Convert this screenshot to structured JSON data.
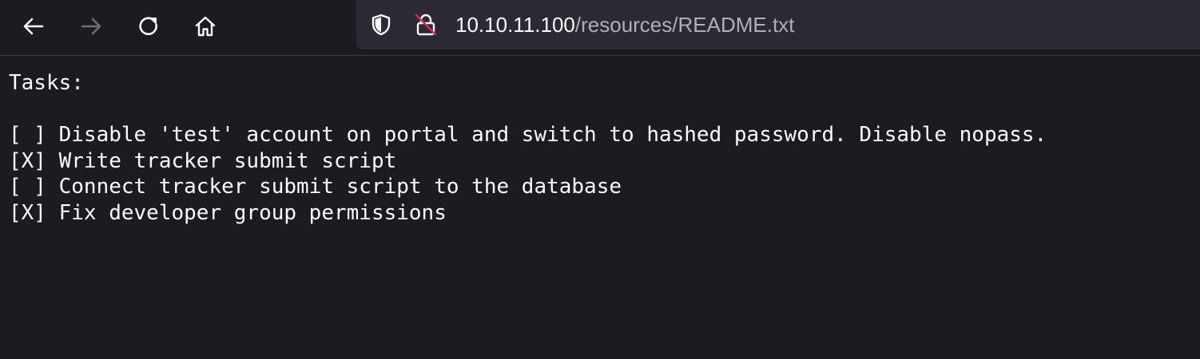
{
  "browser": {
    "url_host": "10.10.11.100",
    "url_path": "/resources/README.txt",
    "icons": {
      "back": "back-arrow-icon",
      "forward": "forward-arrow-icon",
      "reload": "reload-icon",
      "home": "home-icon",
      "tracking": "shield-icon",
      "security": "insecure-lock-icon"
    }
  },
  "document": {
    "lines": [
      "Tasks:",
      "",
      "[ ] Disable 'test' account on portal and switch to hashed password. Disable nopass.",
      "[X] Write tracker submit script",
      "[ ] Connect tracker submit script to the database",
      "[X] Fix developer group permissions"
    ]
  },
  "colors": {
    "background": "#1c1b22",
    "urlbar": "#2b2a33",
    "text": "#fbfbfe",
    "muted": "#b0afb8",
    "insecure_slash": "#e22850"
  }
}
